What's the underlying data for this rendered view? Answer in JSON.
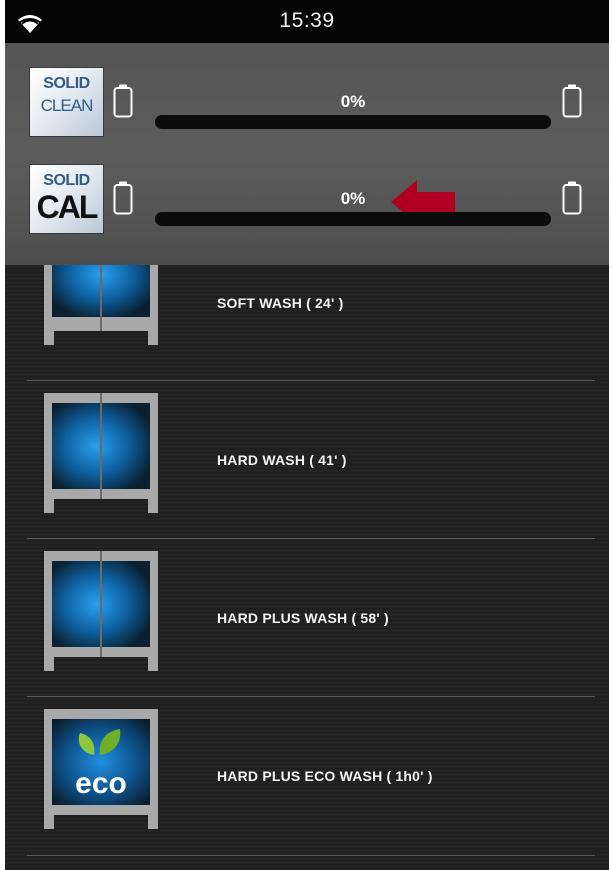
{
  "status_bar": {
    "time": "15:39",
    "wifi_icon": "wifi-icon"
  },
  "consumables": [
    {
      "logo_top": "SOLID",
      "logo_bottom": "CLEAN",
      "percent_label": "0%",
      "level": 0.0
    },
    {
      "logo_top": "SOLID",
      "logo_bottom": "CAL",
      "percent_label": "0%",
      "level": 0.0
    }
  ],
  "programs": [
    {
      "label": "SOFT WASH ( 24' )"
    },
    {
      "label": "HARD WASH ( 41' )"
    },
    {
      "label": "HARD PLUS WASH ( 58' )"
    },
    {
      "label": "HARD PLUS ECO WASH ( 1h0' )",
      "badge": "eco"
    }
  ],
  "colors": {
    "highlight_arrow": "#b00020",
    "panel": "#575757",
    "water": "#1a8ee0",
    "frame_gray": "#a9a9a9"
  }
}
